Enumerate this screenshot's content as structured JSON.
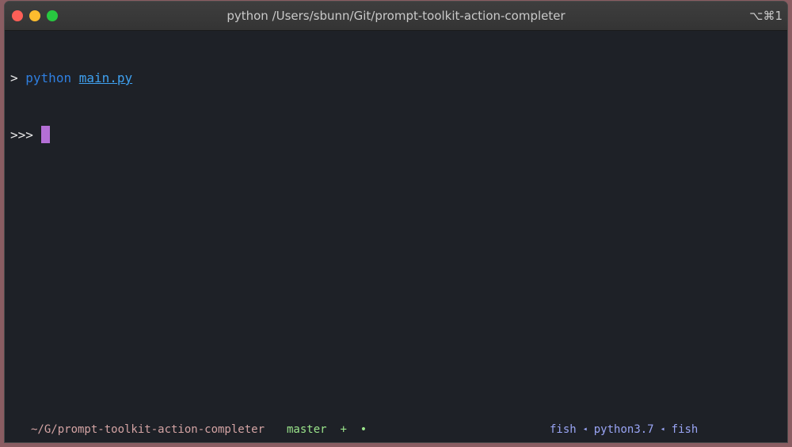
{
  "window": {
    "title": "python /Users/sbunn/Git/prompt-toolkit-action-completer",
    "shortcut": "⌥⌘1"
  },
  "terminal": {
    "prompt_symbol": ">",
    "command": "python",
    "argument": "main.py",
    "repl_prompt": ">>>"
  },
  "statusbar": {
    "path": "~/G/prompt-toolkit-action-completer",
    "git_branch": "master",
    "git_status": "+",
    "git_dirty_dot": "•",
    "processes": [
      "fish",
      "python3.7",
      "fish"
    ],
    "separator": "◂"
  },
  "colors": {
    "background": "#1e2127",
    "cursor": "#b46fd6",
    "command": "#2f7fe0",
    "git": "#9be58b",
    "processes": "#9aa5f5"
  },
  "icons": {
    "folder": "folder-icon",
    "branch": "git-branch-icon",
    "process": "process-tree-icon"
  }
}
